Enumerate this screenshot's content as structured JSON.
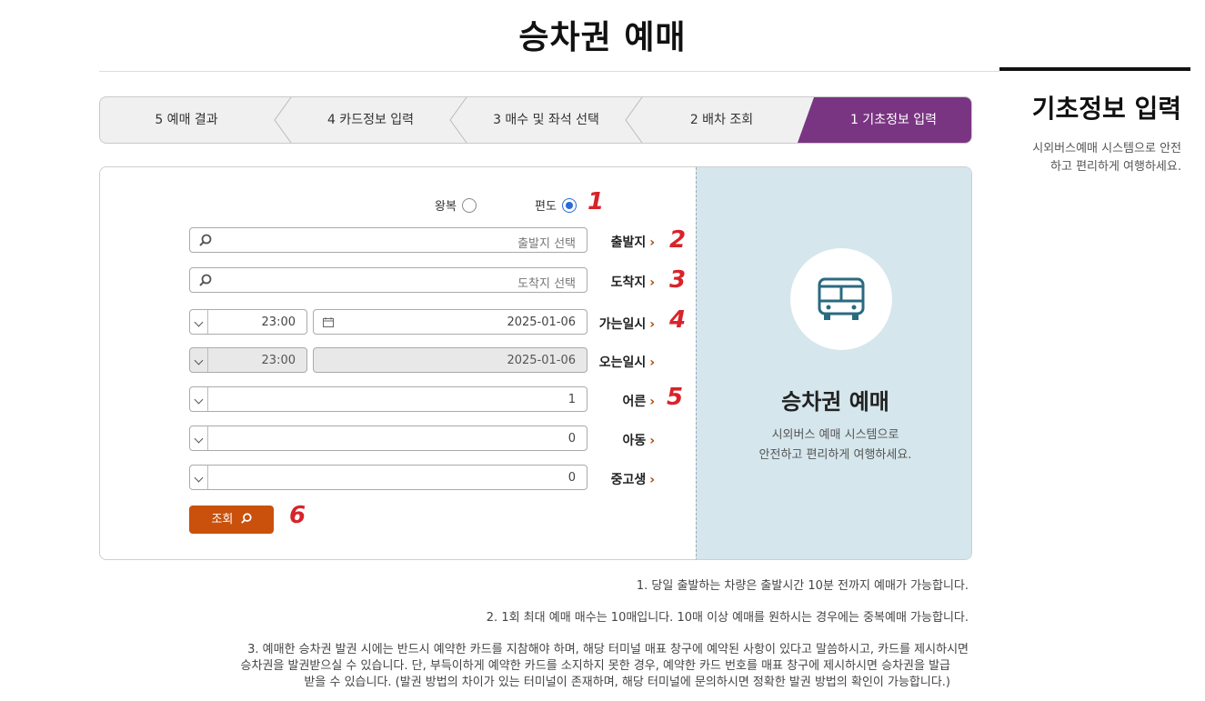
{
  "page": {
    "title": "승차권 예매"
  },
  "side": {
    "title": "기초정보 입력",
    "desc_line1": "시외버스예매 시스템으로 안전",
    "desc_line2": "하고 편리하게 여행하세요."
  },
  "steps": [
    {
      "label": "1 기초정보 입력",
      "active": true
    },
    {
      "label": "2 배차 조회",
      "active": false
    },
    {
      "label": "3 매수 및 좌석 선택",
      "active": false
    },
    {
      "label": "4 카드정보 입력",
      "active": false
    },
    {
      "label": "5 예매 결과",
      "active": false
    }
  ],
  "info_panel": {
    "title": "승차권 예매",
    "desc_line1": "시외버스 예매 시스템으로",
    "desc_line2": "안전하고 편리하게 여행하세요.",
    "icon": "bus-icon"
  },
  "form": {
    "trip_type": {
      "one_way": "편도",
      "round_trip": "왕복",
      "selected": "one_way"
    },
    "departure": {
      "label": "출발지",
      "placeholder": "출발지 선택",
      "value": ""
    },
    "arrival": {
      "label": "도착지",
      "placeholder": "도착지 선택",
      "value": ""
    },
    "go_datetime": {
      "label": "가는일시",
      "date": "2025-01-06",
      "time": "23:00"
    },
    "return_datetime": {
      "label": "오는일시",
      "date": "2025-01-06",
      "time": "23:00"
    },
    "adult": {
      "label": "어른",
      "value": "1"
    },
    "child": {
      "label": "아동",
      "value": "0"
    },
    "teen": {
      "label": "중고생",
      "value": "0"
    },
    "search_button": "조회",
    "markers": [
      "1",
      "2",
      "3",
      "4",
      "5",
      "6"
    ]
  },
  "notes": [
    "1. 당일 출발하는 차량은 출발시간 10분 전까지 예매가 가능합니다.",
    "2. 1회 최대 예매 매수는 10매입니다. 10매 이상 예매를 원하시는 경우에는 중복예매 가능합니다.",
    "3. 예매한 승차권 발권 시에는 반드시 예약한 카드를 지참해야 하며, 해당 터미널 매표 창구에 예약된 사항이 있다고 말씀하시고, 카드를 제시하시면",
    "승차권을 발권받으실 수 있습니다. 단, 부득이하게 예약한 카드를 소지하지 못한 경우, 예약한 카드 번호를 매표 창구에 제시하시면 승차권을 발급",
    "받을 수 있습니다. (발권 방법의 차이가 있는 터미널이 존재하며, 해당 터미널에 문의하시면 정확한 발권 방법의 확인이 가능합니다.)"
  ],
  "colors": {
    "active_step": "#7a3582",
    "search_button": "#c9510c",
    "marker": "#d8232a",
    "info_panel_bg": "#d5e6ec"
  }
}
